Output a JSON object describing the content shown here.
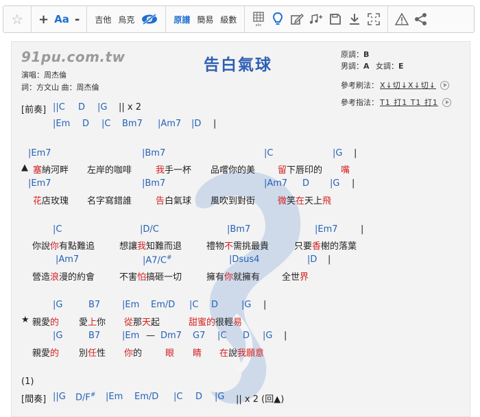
{
  "toolbar": {
    "star_icon": "star-outline",
    "plus": "+",
    "aa": "Aa",
    "minus": "-",
    "instruments": [
      "吉他",
      "烏克"
    ],
    "notation": [
      "原譜",
      "簡易",
      "級數"
    ]
  },
  "sheet": {
    "site": "91pu.com.tw",
    "title": "告白氣球",
    "singer": "演唱：周杰倫",
    "credits": "詞：方文山  曲：周杰倫",
    "orig_key_label": "原調：",
    "orig_key": "B",
    "male_key_label": "男調：",
    "male_key": "A",
    "female_key_label": "女調：",
    "female_key": "E",
    "strum_label": "參考刷法：",
    "strum_pattern": "X↓切↓X↓切↓",
    "finger_label": "參考指法：",
    "finger_pattern": "T1 打1 T1 打1"
  },
  "song": {
    "prelude_label": "[前奏]",
    "prelude_1": [
      "||C",
      "D",
      "|G",
      "|| x 2"
    ],
    "prelude_2": [
      "|Em",
      "D",
      "|C",
      "Bm7",
      "|Am7",
      "|D",
      "|"
    ],
    "v1_chords_1": [
      "|Em7",
      "|Bm7",
      "|C",
      "|G",
      "|"
    ],
    "v1_lyric_1": [
      "▲",
      "塞",
      "納河畔",
      "左岸的咖啡",
      "我",
      "手一杯",
      "品嚐你的美",
      "留",
      "下唇印的",
      "嘴"
    ],
    "v1_chords_2": [
      "|Em7",
      "|Bm7",
      "|Am7",
      "D",
      "|G",
      "|"
    ],
    "v1_lyric_2": [
      "花",
      "店玫瑰",
      "名字寫錯誰",
      "告",
      "白氣球",
      "風吹到對街",
      "微",
      "笑",
      "在",
      "天上",
      "飛"
    ],
    "v2_chords_1": [
      "|C",
      "|D/C",
      "|Bm7",
      "|Em7",
      "|"
    ],
    "v2_lyric_1": [
      "你說",
      "你",
      "有點難追",
      "想讓",
      "我",
      "知難而退",
      "禮物",
      "不",
      "需挑最貴",
      "只要",
      "香",
      "榭的落葉"
    ],
    "v2_chords_2": [
      "|Am7",
      "|A7/C",
      "#",
      "|Dsus4",
      "|D",
      "|"
    ],
    "v2_lyric_2": [
      "營造",
      "浪",
      "漫的約會",
      "不害",
      "怕",
      "搞砸一切",
      "擁有",
      "你",
      "就擁有",
      "全世",
      "界"
    ],
    "ch_chords_1": [
      "|G",
      "B7",
      "|Em",
      "Em/D",
      "|C",
      "D",
      "|G",
      "|"
    ],
    "ch_lyric_1": [
      "★",
      "親愛",
      "的",
      "愛",
      "上",
      "你",
      "從",
      "那",
      "天",
      "起",
      "甜蜜",
      "的",
      "很輕",
      "易"
    ],
    "ch_chords_2": [
      "|G",
      "B7",
      "|Em",
      "—",
      "Dm7",
      "G7",
      "|C",
      "D",
      "|G",
      "|"
    ],
    "ch_lyric_2": [
      "親愛",
      "的",
      "別",
      "任",
      "性",
      "你",
      "的",
      "眼",
      "睛",
      "在",
      "說",
      "我",
      "願",
      "意"
    ],
    "marker": "(1)",
    "interlude_label": "[間奏]",
    "interlude": [
      "||G",
      "D/F",
      "#",
      "|Em",
      "Em/D",
      "|C",
      "D",
      "|G",
      "|| x 2  (回▲)"
    ]
  }
}
